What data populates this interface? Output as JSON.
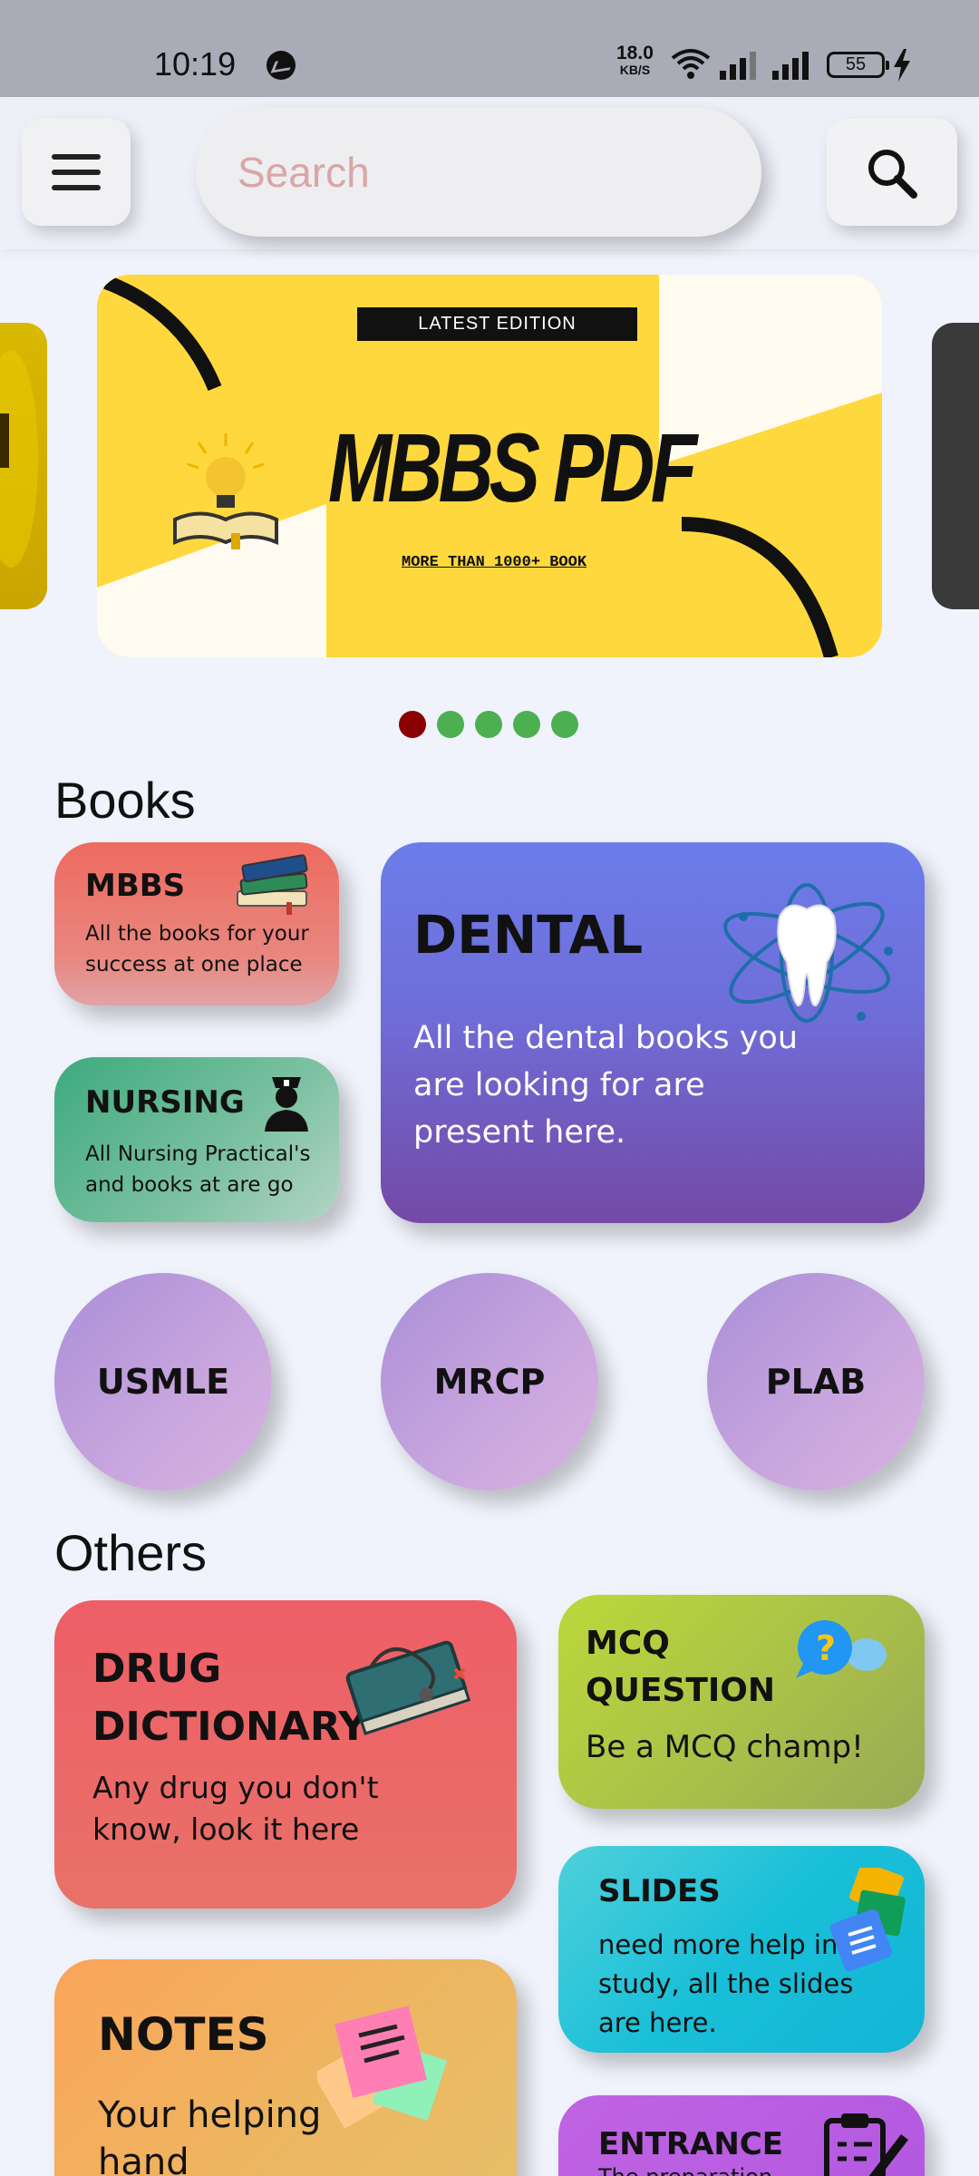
{
  "status_bar": {
    "time": "10:19",
    "net_speed": "18.0",
    "net_speed_unit": "KB/S",
    "battery": "55"
  },
  "search": {
    "placeholder": "Search"
  },
  "banner": {
    "tag": "LATEST EDITION",
    "title": "MBBS PDF",
    "subtitle": "MORE THAN 1000+ BOOK",
    "active_dot": 1,
    "dot_count": 5,
    "colors": {
      "active_dot": "#8B0000",
      "dot": "#4CAF50"
    }
  },
  "books": {
    "heading": "Books",
    "mbbs": {
      "title": "MBBS",
      "desc": "All the books for your success at one place"
    },
    "nursing": {
      "title": "NURSING",
      "desc": "All Nursing Practical's and books at are go"
    },
    "dental": {
      "title": "DENTAL",
      "desc": "All the dental books you are looking for are present here."
    },
    "circles": [
      "USMLE",
      "MRCP",
      "PLAB"
    ]
  },
  "others": {
    "heading": "Others",
    "drug": {
      "title": "DRUG DICTIONARY",
      "desc": "Any drug you don't know, look it here"
    },
    "mcq": {
      "title": "MCQ QUESTION",
      "desc": "Be a MCQ champ!"
    },
    "slides": {
      "title": "SLIDES",
      "desc": "need more help in study, all the slides are here."
    },
    "notes": {
      "title": "NOTES",
      "desc": "Your helping hand"
    },
    "entrance": {
      "title": "ENTRANCE",
      "desc": "The preparation"
    }
  },
  "icons": {
    "menu": "hamburger-icon",
    "search": "search-icon",
    "mbbs": "books-stack-icon",
    "nursing": "nurse-icon",
    "dental": "tooth-atom-icon",
    "drug": "medical-book-stethoscope-icon",
    "mcq": "question-chat-icon",
    "slides": "slides-icon",
    "notes": "sticky-notes-icon",
    "entrance": "clipboard-pen-icon"
  }
}
